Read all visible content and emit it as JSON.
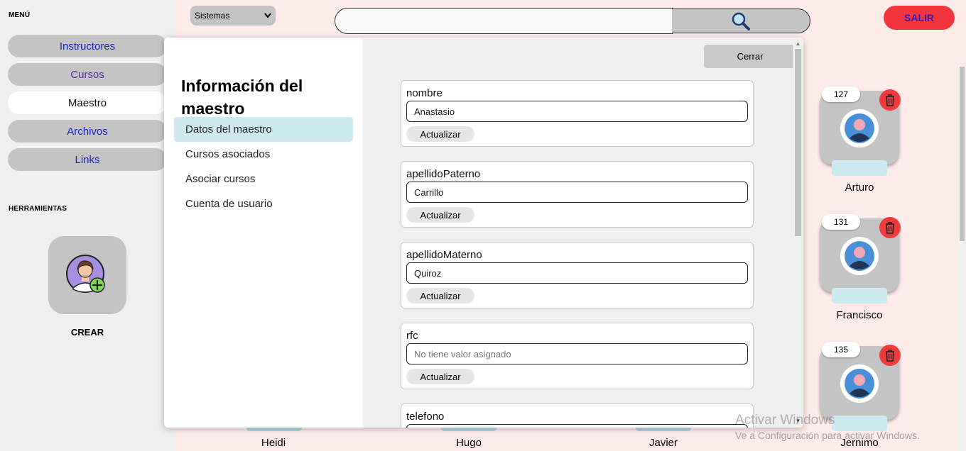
{
  "sidebar": {
    "menu_heading": "MENÚ",
    "items": [
      {
        "label": "Instructores"
      },
      {
        "label": "Cursos"
      },
      {
        "label": "Maestro"
      },
      {
        "label": "Archivos"
      },
      {
        "label": "Links"
      }
    ],
    "tools_heading": "HERRAMIENTAS",
    "create_label": "CREAR",
    "create_icon": "add-teacher-icon"
  },
  "topbar": {
    "select_value": "Sistemas",
    "search_value": "",
    "search_icon": "search-icon",
    "logout_label": "SALIR",
    "logout_color": "#f5353e"
  },
  "teachers_right": [
    {
      "number": "127",
      "name": "Arturo"
    },
    {
      "number": "131",
      "name": "Francisco"
    },
    {
      "number": "135",
      "name": "Jernimo"
    }
  ],
  "teachers_bottom": [
    {
      "name": "Heidi"
    },
    {
      "name": "Hugo"
    },
    {
      "name": "Javier"
    }
  ],
  "modal": {
    "title": "Información del maestro",
    "close_label": "Cerrar",
    "nav": [
      {
        "label": "Datos del maestro",
        "active": true
      },
      {
        "label": "Cursos asociados"
      },
      {
        "label": "Asociar cursos"
      },
      {
        "label": "Cuenta de usuario"
      }
    ],
    "fields": [
      {
        "label": "nombre",
        "value": "Anastasio",
        "button": "Actualizar"
      },
      {
        "label": "apellidoPaterno",
        "value": "Carrillo",
        "button": "Actualizar"
      },
      {
        "label": "apellidoMaterno",
        "value": "Quiroz",
        "button": "Actualizar"
      },
      {
        "label": "rfc",
        "placeholder": "No tiene valor asignado",
        "button": "Actualizar"
      },
      {
        "label": "telefono"
      }
    ]
  },
  "watermark": {
    "line1": "Activar Windows",
    "line2": "Ve a Configuración para activar Windows."
  }
}
